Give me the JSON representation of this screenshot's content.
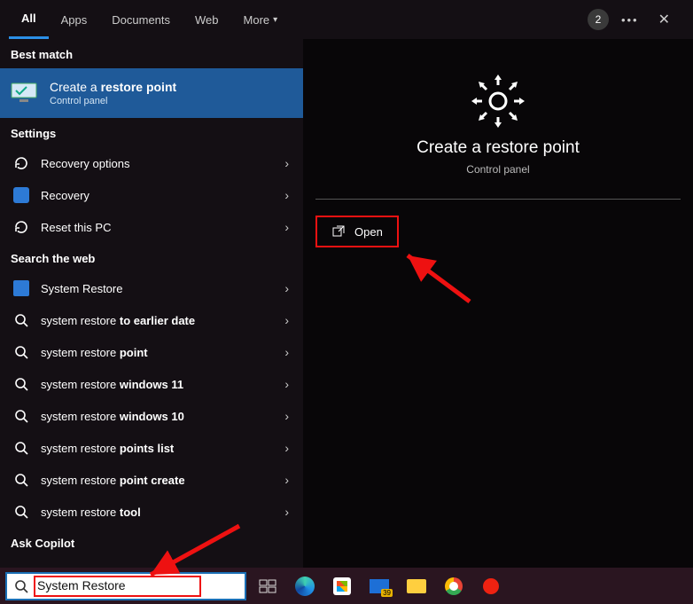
{
  "tabs": {
    "items": [
      "All",
      "Apps",
      "Documents",
      "Web",
      "More"
    ],
    "active": "All",
    "badge_count": "2"
  },
  "left": {
    "best_match_label": "Best match",
    "best_match": {
      "title_pre": "Create a ",
      "title_bold": "restore point",
      "subtitle": "Control panel"
    },
    "settings_label": "Settings",
    "settings": [
      "Recovery options",
      "Recovery",
      "Reset this PC"
    ],
    "web_label": "Search the web",
    "web": [
      {
        "pre": "System Restore",
        "bold": "",
        "icon": "app"
      },
      {
        "pre": "system restore ",
        "bold": "to earlier date",
        "icon": "search"
      },
      {
        "pre": "system restore ",
        "bold": "point",
        "icon": "search"
      },
      {
        "pre": "system restore ",
        "bold": "windows 11",
        "icon": "search"
      },
      {
        "pre": "system restore ",
        "bold": "windows 10",
        "icon": "search"
      },
      {
        "pre": "system restore ",
        "bold": "points list",
        "icon": "search"
      },
      {
        "pre": "system restore ",
        "bold": "point create",
        "icon": "search"
      },
      {
        "pre": "system restore ",
        "bold": "tool",
        "icon": "search"
      }
    ],
    "copilot_label": "Ask Copilot"
  },
  "right": {
    "title": "Create a restore point",
    "subtitle": "Control panel",
    "open_label": "Open"
  },
  "taskbar": {
    "search_value": "System Restore",
    "mail_badge": "39"
  }
}
